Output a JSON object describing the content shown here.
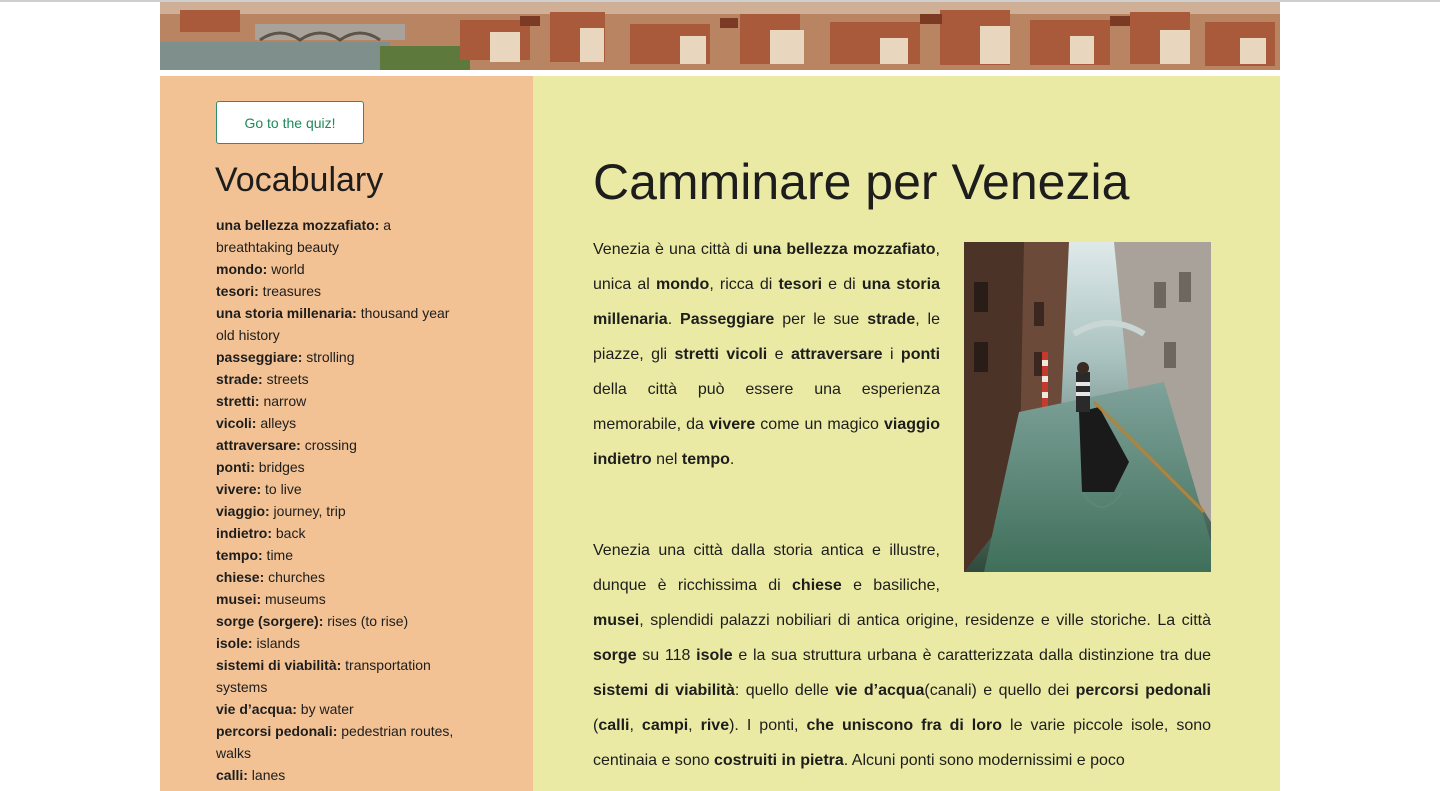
{
  "quiz_button": {
    "label": "Go to the quiz!"
  },
  "sidebar": {
    "title": "Vocabulary",
    "items": [
      {
        "term": "una bellezza mozzafiato:",
        "meaning": "a breathtaking beauty"
      },
      {
        "term": "mondo:",
        "meaning": "world"
      },
      {
        "term": "tesori:",
        "meaning": "treasures"
      },
      {
        "term": "una storia millenaria:",
        "meaning": "thousand year old history"
      },
      {
        "term": "passeggiare:",
        "meaning": "strolling"
      },
      {
        "term": "strade:",
        "meaning": "streets"
      },
      {
        "term": "stretti:",
        "meaning": "narrow"
      },
      {
        "term": "vicoli:",
        "meaning": "alleys"
      },
      {
        "term": "attraversare:",
        "meaning": "crossing"
      },
      {
        "term": "ponti:",
        "meaning": "bridges"
      },
      {
        "term": "vivere:",
        "meaning": "to live"
      },
      {
        "term": "viaggio:",
        "meaning": "journey, trip"
      },
      {
        "term": "indietro:",
        "meaning": "back"
      },
      {
        "term": "tempo:",
        "meaning": "time"
      },
      {
        "term": "chiese:",
        "meaning": "churches"
      },
      {
        "term": "musei:",
        "meaning": "museums"
      },
      {
        "term": "sorge (sorgere):",
        "meaning": "rises (to rise)"
      },
      {
        "term": "isole:",
        "meaning": "islands"
      },
      {
        "term": "sistemi di viabilità:",
        "meaning": "transportation systems"
      },
      {
        "term": "vie d’acqua:",
        "meaning": "by water"
      },
      {
        "term": "percorsi pedonali:",
        "meaning": "pedestrian routes, walks"
      },
      {
        "term": "calli:",
        "meaning": "lanes"
      }
    ]
  },
  "article": {
    "title": "Camminare per Venezia",
    "paragraphs": [
      [
        {
          "t": "Venezia è una città di "
        },
        {
          "t": "una bellezza mozzafiato",
          "b": true
        },
        {
          "t": ", unica al "
        },
        {
          "t": "mondo",
          "b": true
        },
        {
          "t": ", ricca di "
        },
        {
          "t": "tesori",
          "b": true
        },
        {
          "t": " e di "
        },
        {
          "t": "una storia millenaria",
          "b": true
        },
        {
          "t": ". "
        },
        {
          "t": "Passeggiare",
          "b": true
        },
        {
          "t": " per le sue "
        },
        {
          "t": "strade",
          "b": true
        },
        {
          "t": ", le piazze, gli "
        },
        {
          "t": "stretti vicoli",
          "b": true
        },
        {
          "t": " e "
        },
        {
          "t": "attraversare",
          "b": true
        },
        {
          "t": " i "
        },
        {
          "t": "ponti",
          "b": true
        },
        {
          "t": " della città può essere una esperienza memorabile, da "
        },
        {
          "t": "vivere",
          "b": true
        },
        {
          "t": " come un magico "
        },
        {
          "t": "viaggio indietro",
          "b": true
        },
        {
          "t": " nel "
        },
        {
          "t": "tempo",
          "b": true
        },
        {
          "t": "."
        }
      ],
      [
        {
          "t": "Venezia una città dalla storia antica e illustre, dunque è ricchissima di "
        },
        {
          "t": "chiese",
          "b": true
        },
        {
          "t": " e basiliche, "
        },
        {
          "t": "musei",
          "b": true
        },
        {
          "t": ", splendidi palazzi nobiliari di antica origine, residenze e ville storiche. La città "
        },
        {
          "t": "sorge",
          "b": true
        },
        {
          "t": " su 118 "
        },
        {
          "t": "isole",
          "b": true
        },
        {
          "t": " e la sua struttura urbana è caratterizzata dalla distinzione tra due "
        },
        {
          "t": "sistemi di viabilità",
          "b": true
        },
        {
          "t": ": quello delle "
        },
        {
          "t": "vie d’acqua",
          "b": true
        },
        {
          "t": "(canali) e quello dei "
        },
        {
          "t": "percorsi pedonali",
          "b": true
        },
        {
          "t": " ("
        },
        {
          "t": "calli",
          "b": true
        },
        {
          "t": ", "
        },
        {
          "t": "campi",
          "b": true
        },
        {
          "t": ", "
        },
        {
          "t": "rive",
          "b": true
        },
        {
          "t": "). I ponti, "
        },
        {
          "t": "che uniscono fra di loro",
          "b": true
        },
        {
          "t": " le varie piccole isole, sono centinaia e sono "
        },
        {
          "t": "costruiti in pietra",
          "b": true
        },
        {
          "t": ". Alcuni ponti sono modernissimi e "
        },
        {
          "t": "poco"
        }
      ]
    ]
  }
}
